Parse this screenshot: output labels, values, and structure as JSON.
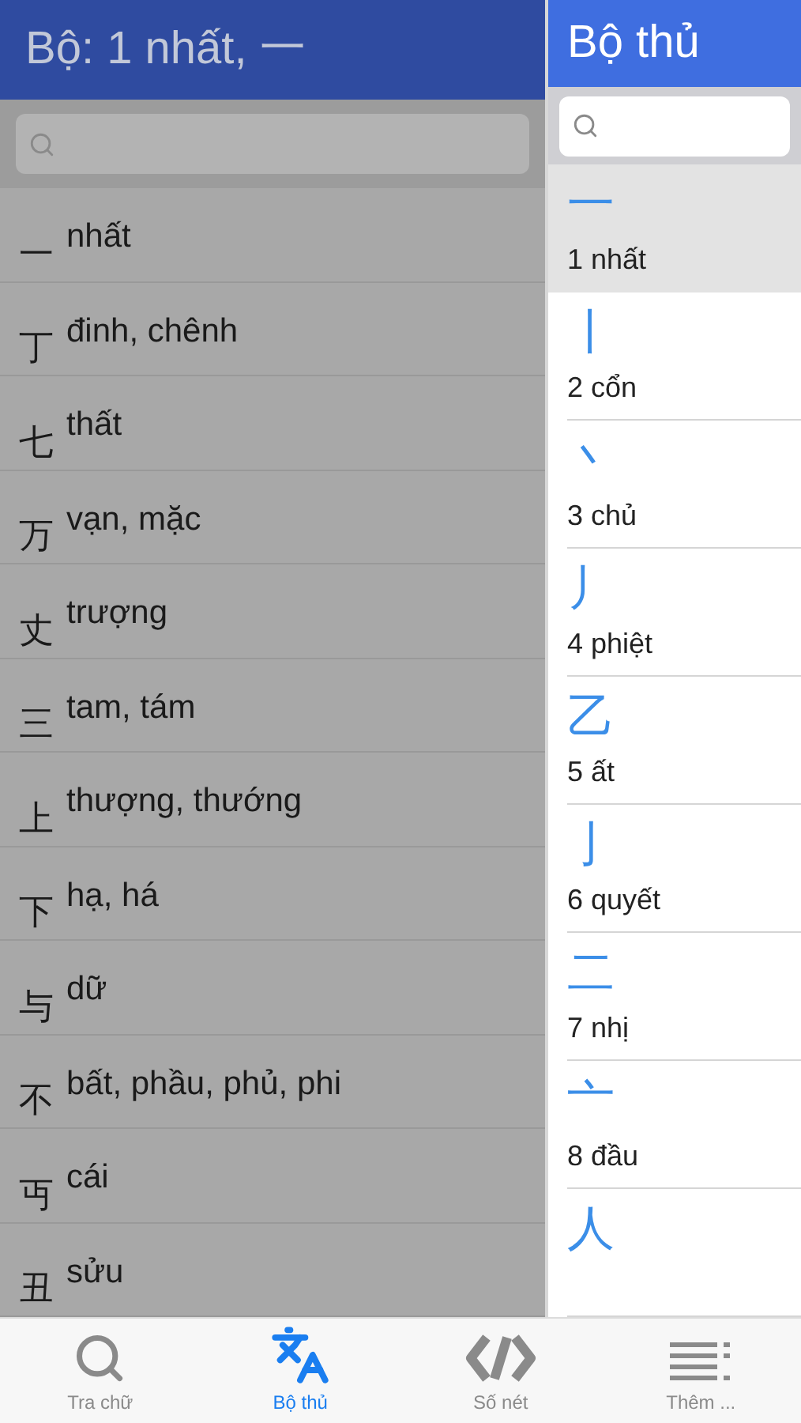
{
  "left_panel": {
    "title": "Bộ: 1 nhất, 一",
    "dimmed": true,
    "items": [
      {
        "char": "一",
        "reading": "nhất"
      },
      {
        "char": "丁",
        "reading": "đinh, chênh"
      },
      {
        "char": "七",
        "reading": "thất"
      },
      {
        "char": "万",
        "reading": "vạn, mặc"
      },
      {
        "char": "丈",
        "reading": "trượng"
      },
      {
        "char": "三",
        "reading": "tam, tám"
      },
      {
        "char": "上",
        "reading": "thượng, thướng"
      },
      {
        "char": "下",
        "reading": "hạ, há"
      },
      {
        "char": "与",
        "reading": "dữ"
      },
      {
        "char": "不",
        "reading": "bất, phầu, phủ, phi"
      },
      {
        "char": "丏",
        "reading": "cái"
      },
      {
        "char": "丑",
        "reading": "sửu"
      }
    ]
  },
  "right_panel": {
    "title": "Bộ thủ",
    "radicals": [
      {
        "glyph": "一",
        "label": "1 nhất",
        "selected": true
      },
      {
        "glyph": "丨",
        "label": "2 cổn",
        "selected": false
      },
      {
        "glyph": "丶",
        "label": "3 chủ",
        "selected": false
      },
      {
        "glyph": "丿",
        "label": "4 phiệt",
        "selected": false
      },
      {
        "glyph": "乙",
        "label": "5 ất",
        "selected": false
      },
      {
        "glyph": "亅",
        "label": "6 quyết",
        "selected": false
      },
      {
        "glyph": "二",
        "label": "7 nhị",
        "selected": false
      },
      {
        "glyph": "亠",
        "label": "8 đầu",
        "selected": false
      },
      {
        "glyph": "人",
        "selected": false
      }
    ]
  },
  "tab_bar": [
    {
      "kind": "search",
      "label": "Tra chữ",
      "selected": false
    },
    {
      "kind": "translate",
      "label": "Bộ thủ",
      "selected": true
    },
    {
      "kind": "strokes",
      "label": "Số nét",
      "selected": false
    },
    {
      "kind": "more",
      "label": "Thêm ...",
      "selected": false
    }
  ]
}
